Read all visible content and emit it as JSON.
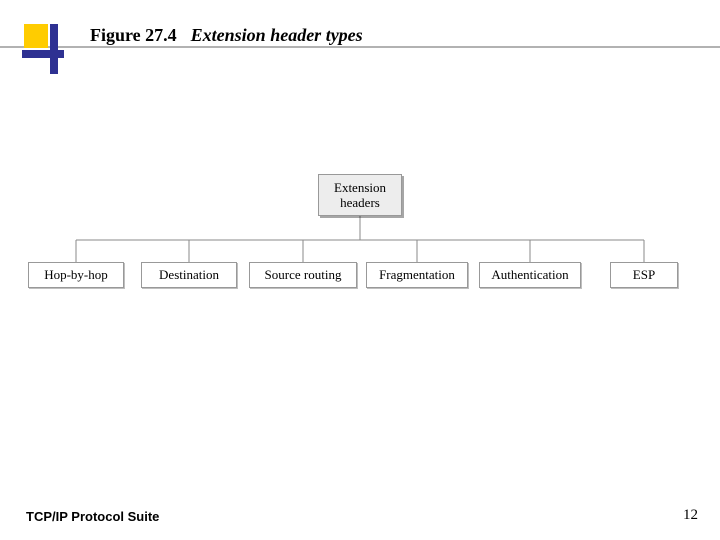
{
  "header": {
    "figure_number": "Figure 27.4",
    "figure_title": "Extension header types"
  },
  "diagram": {
    "root_line1": "Extension",
    "root_line2": "headers",
    "leaves": [
      "Hop-by-hop",
      "Destination",
      "Source routing",
      "Fragmentation",
      "Authentication",
      "ESP"
    ]
  },
  "footer": {
    "left": "TCP/IP Protocol Suite",
    "page": "12"
  }
}
